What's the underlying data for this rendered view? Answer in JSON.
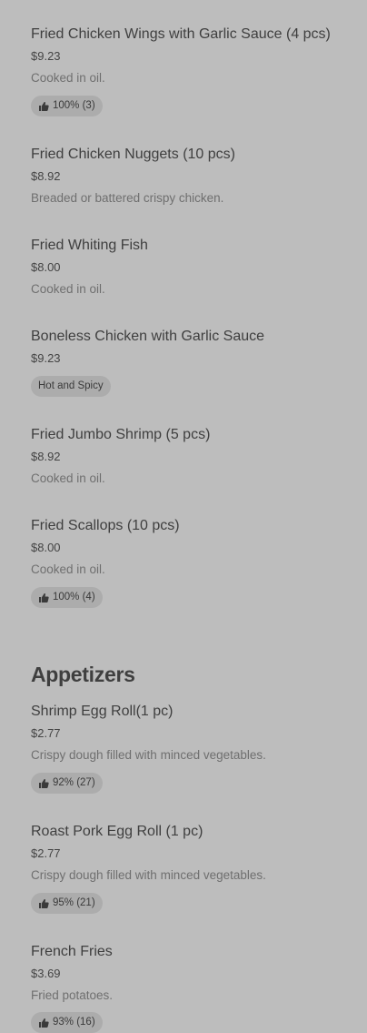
{
  "menu": {
    "items_top": [
      {
        "name": "Fried Chicken Wings with Garlic Sauce (4 pcs)",
        "price": "$9.23",
        "description": "Cooked in oil.",
        "rating": "100% (3)"
      },
      {
        "name": "Fried Chicken Nuggets (10 pcs)",
        "price": "$8.92",
        "description": "Breaded or battered crispy chicken."
      },
      {
        "name": "Fried Whiting Fish",
        "price": "$8.00",
        "description": "Cooked in oil."
      },
      {
        "name": "Boneless Chicken with Garlic Sauce",
        "price": "$9.23",
        "tag": "Hot and Spicy"
      },
      {
        "name": "Fried Jumbo Shrimp (5 pcs)",
        "price": "$8.92",
        "description": "Cooked in oil."
      },
      {
        "name": "Fried Scallops (10 pcs)",
        "price": "$8.00",
        "description": "Cooked in oil.",
        "rating": "100% (4)"
      }
    ],
    "section_title": "Appetizers",
    "items_appetizers": [
      {
        "name": "Shrimp Egg Roll(1 pc)",
        "price": "$2.77",
        "description": "Crispy dough filled with minced vegetables.",
        "rating": "92% (27)"
      },
      {
        "name": "Roast Pork Egg Roll (1 pc)",
        "price": "$2.77",
        "description": "Crispy dough filled with minced vegetables.",
        "rating": "95% (21)"
      },
      {
        "name": "French Fries",
        "price": "$3.69",
        "description": "Fried potatoes.",
        "rating": "93% (16)"
      }
    ],
    "icon": "thumbs-up-icon",
    "colors": {
      "background": "#bdbdbd",
      "pill": "#acacac"
    }
  }
}
